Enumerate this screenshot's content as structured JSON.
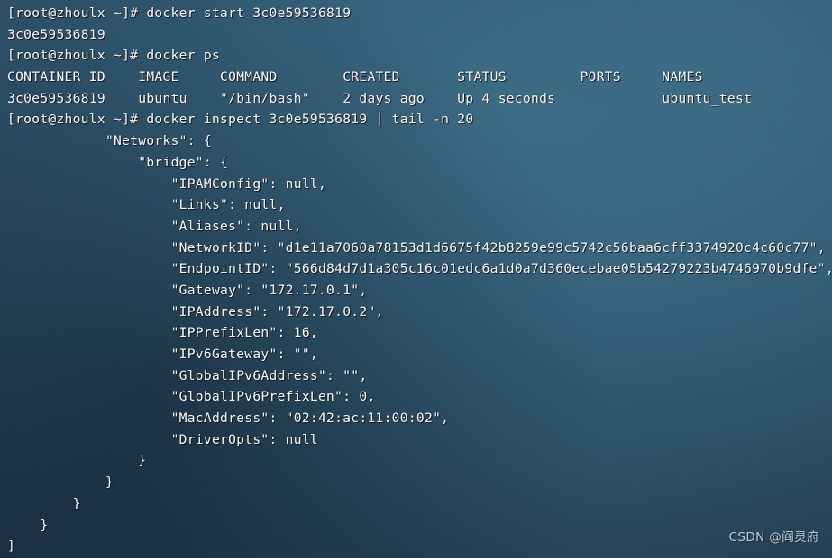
{
  "terminal": {
    "prompt": "[root@zhoulx ~]#",
    "colors": {
      "background_light": "#3c6a83",
      "background_mid": "#2d5168",
      "background_dark": "#1b2f41",
      "text": "#ffffff"
    },
    "lines": [
      "[root@zhoulx ~]# docker start 3c0e59536819",
      "3c0e59536819",
      "[root@zhoulx ~]# docker ps",
      "CONTAINER ID    IMAGE     COMMAND        CREATED       STATUS         PORTS     NAMES",
      "3c0e59536819    ubuntu    \"/bin/bash\"    2 days ago    Up 4 seconds             ubuntu_test",
      "[root@zhoulx ~]# docker inspect 3c0e59536819 | tail -n 20",
      "            \"Networks\": {",
      "                \"bridge\": {",
      "                    \"IPAMConfig\": null,",
      "                    \"Links\": null,",
      "                    \"Aliases\": null,",
      "                    \"NetworkID\": \"d1e11a7060a78153d1d6675f42b8259e99c5742c56baa6cff3374920c4c60c77\",",
      "                    \"EndpointID\": \"566d84d7d1a305c16c01edc6a1d0a7d360ecebae05b54279223b4746970b9dfe\",",
      "                    \"Gateway\": \"172.17.0.1\",",
      "                    \"IPAddress\": \"172.17.0.2\",",
      "                    \"IPPrefixLen\": 16,",
      "                    \"IPv6Gateway\": \"\",",
      "                    \"GlobalIPv6Address\": \"\",",
      "                    \"GlobalIPv6PrefixLen\": 0,",
      "                    \"MacAddress\": \"02:42:ac:11:00:02\",",
      "                    \"DriverOpts\": null",
      "                }",
      "            }",
      "        }",
      "    }",
      "]"
    ]
  },
  "commands": {
    "start": "docker start 3c0e59536819",
    "ps": "docker ps",
    "inspect": "docker inspect 3c0e59536819 | tail -n 20"
  },
  "container_table": {
    "headers": [
      "CONTAINER ID",
      "IMAGE",
      "COMMAND",
      "CREATED",
      "STATUS",
      "PORTS",
      "NAMES"
    ],
    "rows": [
      {
        "container_id": "3c0e59536819",
        "image": "ubuntu",
        "command": "\"/bin/bash\"",
        "created": "2 days ago",
        "status": "Up 4 seconds",
        "ports": "",
        "names": "ubuntu_test"
      }
    ]
  },
  "inspect_output": {
    "networks": {
      "bridge": {
        "IPAMConfig": "null",
        "Links": "null",
        "Aliases": "null",
        "NetworkID": "d1e11a7060a78153d1d6675f42b8259e99c5742c56baa6cff3374920c4c60c77",
        "EndpointID": "566d84d7d1a305c16c01edc6a1d0a7d360ecebae05b54279223b4746970b9dfe",
        "Gateway": "172.17.0.1",
        "IPAddress": "172.17.0.2",
        "IPPrefixLen": "16",
        "IPv6Gateway": "",
        "GlobalIPv6Address": "",
        "GlobalIPv6PrefixLen": "0",
        "MacAddress": "02:42:ac:11:00:02",
        "DriverOpts": "null"
      }
    }
  },
  "watermark": {
    "text": "CSDN @阎灵府"
  }
}
